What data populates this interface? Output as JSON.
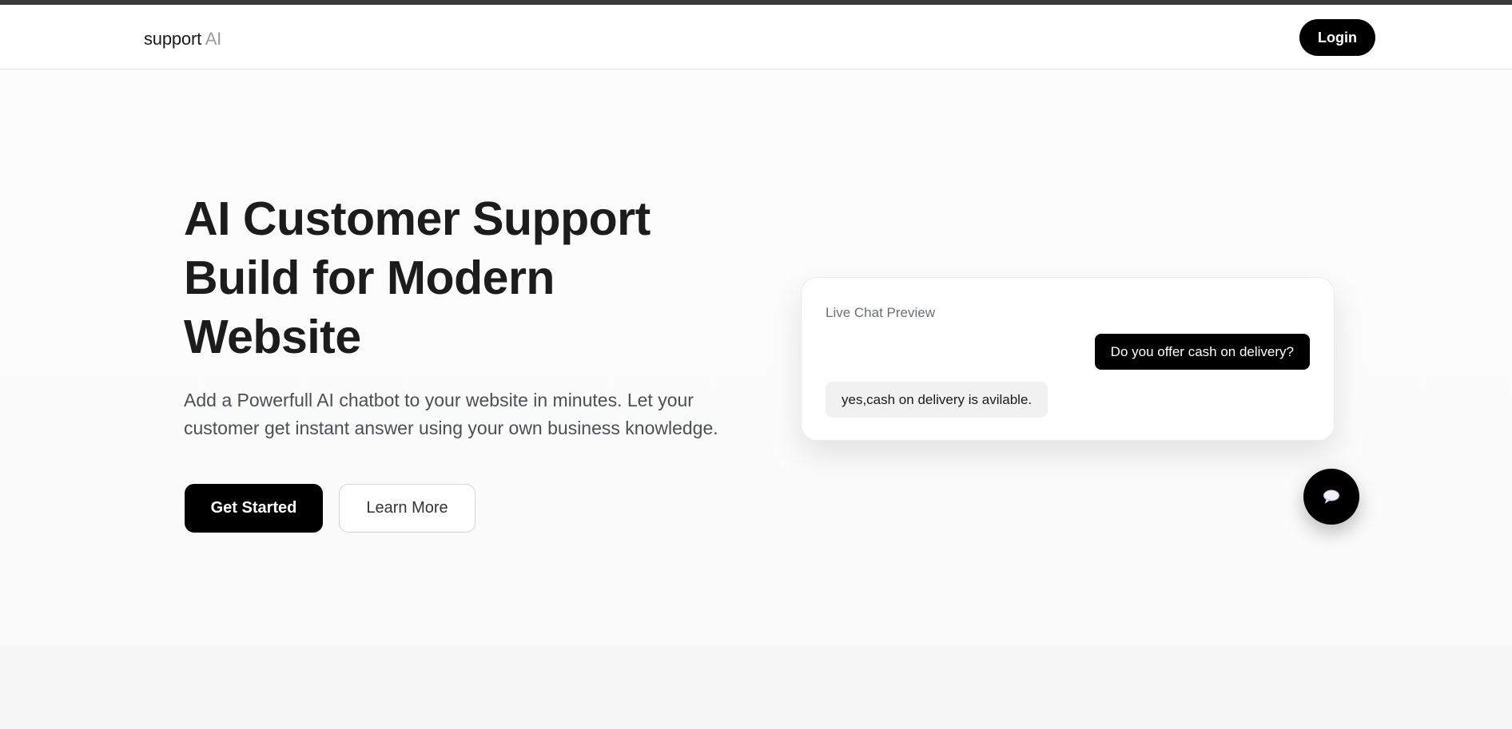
{
  "header": {
    "logo_main": "support",
    "logo_accent": "AI",
    "login_label": "Login"
  },
  "hero": {
    "title_lines": [
      "AI Customer Support",
      "Build for Modern",
      "Website"
    ],
    "subtitle_line1": "Add a Powerfull AI chatbot to your website in minutes. Let your",
    "subtitle_line2": "customer get instant answer using your own business knowledge.",
    "primary_cta": "Get Started",
    "secondary_cta": "Learn More"
  },
  "chat_preview": {
    "title": "Live Chat Preview",
    "user_message": "Do you offer cash on delivery?",
    "bot_message": "yes,cash on delivery is avilable.",
    "fab_icon": "speech-bubble-icon"
  },
  "colors": {
    "accent": "#000000",
    "logo_accent": "#9a9aa3",
    "bot_bubble": "#f1f1f1"
  }
}
